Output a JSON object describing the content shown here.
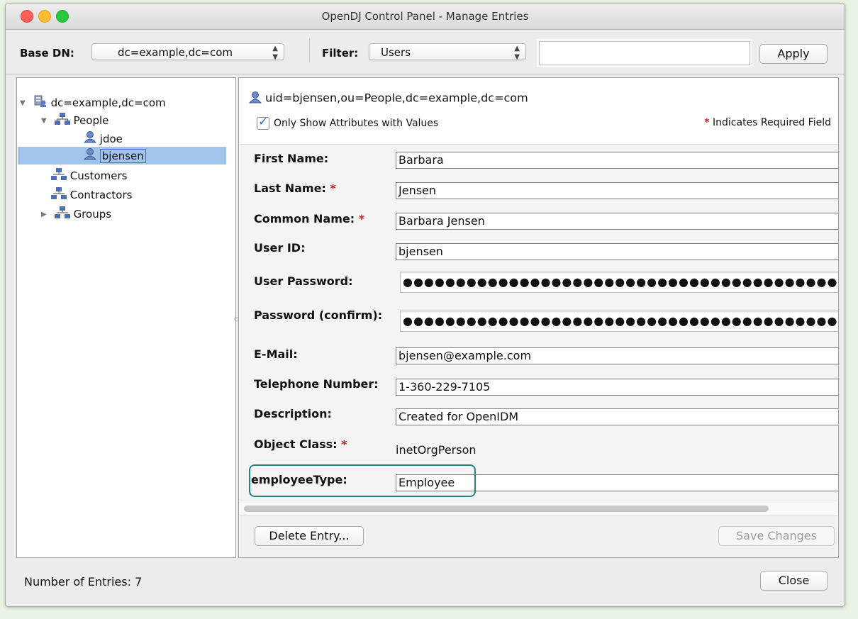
{
  "window": {
    "title": "OpenDJ Control Panel - Manage Entries"
  },
  "toolbar": {
    "base_dn_label": "Base DN:",
    "base_dn_value": "dc=example,dc=com",
    "filter_label": "Filter:",
    "filter_value": "Users",
    "filter_text": "",
    "apply_label": "Apply"
  },
  "tree": {
    "root": "dc=example,dc=com",
    "people": "People",
    "jdoe": "jdoe",
    "bjensen": "bjensen",
    "customers": "Customers",
    "contractors": "Contractors",
    "groups": "Groups"
  },
  "entry": {
    "dn": "uid=bjensen,ou=People,dc=example,dc=com",
    "only_show_label": "Only Show Attributes with Values",
    "required_note": "Indicates Required Field",
    "required_mark": "*",
    "fields": {
      "first_name": {
        "label": "First Name:",
        "value": "Barbara"
      },
      "last_name": {
        "label": "Last Name:",
        "value": "Jensen"
      },
      "common_name": {
        "label": "Common Name:",
        "value": "Barbara Jensen"
      },
      "user_id": {
        "label": "User ID:",
        "value": "bjensen"
      },
      "user_password": {
        "label": "User Password:",
        "value": "●●●●●●●●●●●●●●●●●●●●●●●●●●●●●●●●●●●●●●●●●●●●●●●●●●●●"
      },
      "password_confirm": {
        "label": "Password (confirm):",
        "value": "●●●●●●●●●●●●●●●●●●●●●●●●●●●●●●●●●●●●●●●●●●●●●●●●●●●●"
      },
      "email": {
        "label": "E-Mail:",
        "value": "bjensen@example.com"
      },
      "telephone": {
        "label": "Telephone Number:",
        "value": "1-360-229-7105"
      },
      "description": {
        "label": "Description:",
        "value": "Created for OpenIDM"
      },
      "object_class": {
        "label": "Object Class:",
        "value": "inetOrgPerson"
      },
      "employee_type": {
        "label": "employeeType:",
        "value": "Employee"
      }
    },
    "delete_label": "Delete Entry...",
    "save_label": "Save Changes"
  },
  "status": {
    "entries_text": "Number of Entries: 7",
    "close_label": "Close"
  },
  "colors": {
    "selection": "#a3c4ea",
    "highlight_box": "#22867a",
    "required_star": "#c82222"
  },
  "icons": [
    "server-icon",
    "org-unit-icon",
    "user-icon",
    "disclosure-triangle-icon",
    "checkbox-checked-icon"
  ]
}
